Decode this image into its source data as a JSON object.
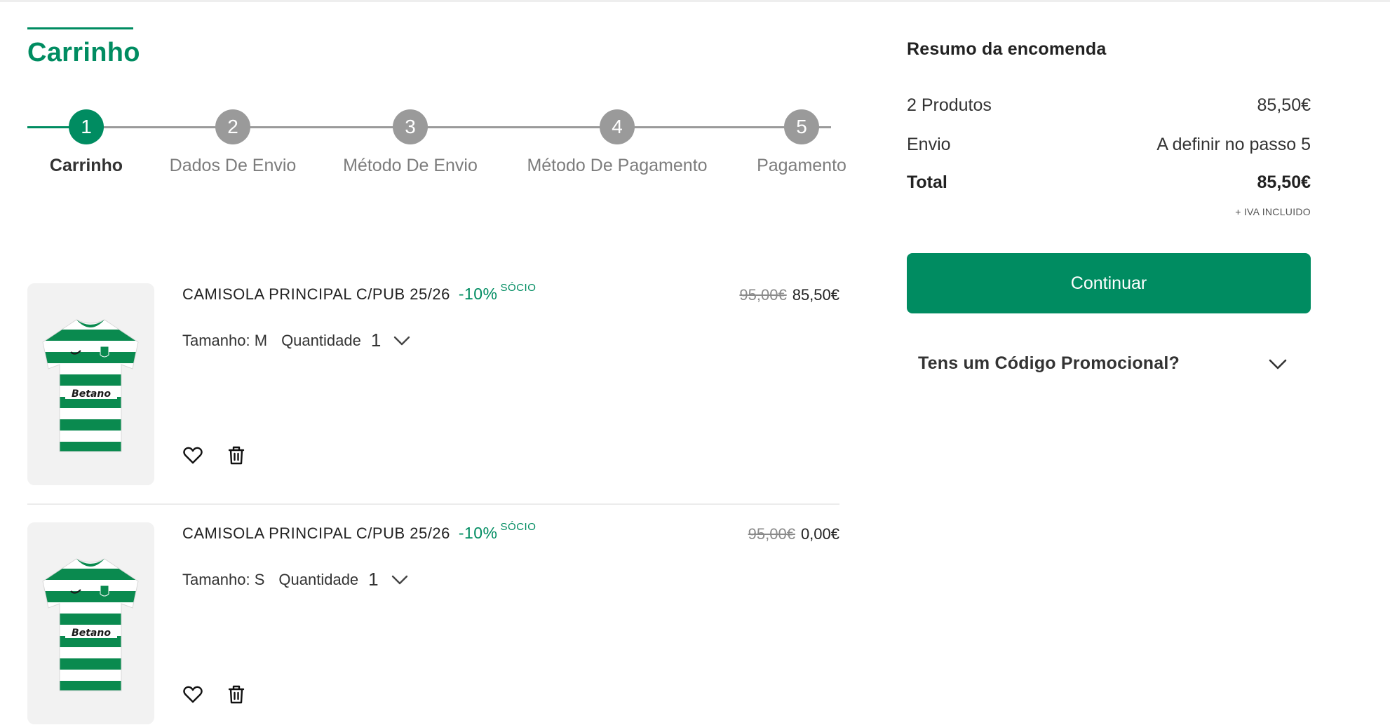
{
  "page": {
    "title": "Carrinho"
  },
  "stepper": {
    "steps": [
      {
        "number": "1",
        "label": "Carrinho",
        "active": true
      },
      {
        "number": "2",
        "label": "Dados De Envio",
        "active": false
      },
      {
        "number": "3",
        "label": "Método De Envio",
        "active": false
      },
      {
        "number": "4",
        "label": "Método De Pagamento",
        "active": false
      },
      {
        "number": "5",
        "label": "Pagamento",
        "active": false
      }
    ]
  },
  "cart": {
    "items": [
      {
        "name": "CAMISOLA PRINCIPAL C/PUB 25/26",
        "discount": "-10%",
        "member_label": "SÓCIO",
        "old_price": "95,00€",
        "price": "85,50€",
        "size_label": "Tamanho: M",
        "quantity_label": "Quantidade",
        "quantity": "1"
      },
      {
        "name": "CAMISOLA PRINCIPAL C/PUB 25/26",
        "discount": "-10%",
        "member_label": "SÓCIO",
        "old_price": "95,00€",
        "price": "0,00€",
        "size_label": "Tamanho: S",
        "quantity_label": "Quantidade",
        "quantity": "1"
      }
    ]
  },
  "summary": {
    "title": "Resumo da encomenda",
    "products_label": "2 Produtos",
    "products_value": "85,50€",
    "shipping_label": "Envio",
    "shipping_value": "A definir no passo 5",
    "total_label": "Total",
    "total_value": "85,50€",
    "tax_note": "+ IVA INCLUIDO",
    "continue_label": "Continuar",
    "promo_label": "Tens um Código Promocional?"
  },
  "colors": {
    "brand": "#008c61",
    "inactive_step": "#9a9a9a",
    "text": "#222222",
    "muted": "#8a8a8a"
  },
  "icons": {
    "wishlist": "heart-icon",
    "remove": "trash-icon",
    "quantity_toggle": "chevron-down-icon",
    "promo_toggle": "chevron-down-icon"
  }
}
